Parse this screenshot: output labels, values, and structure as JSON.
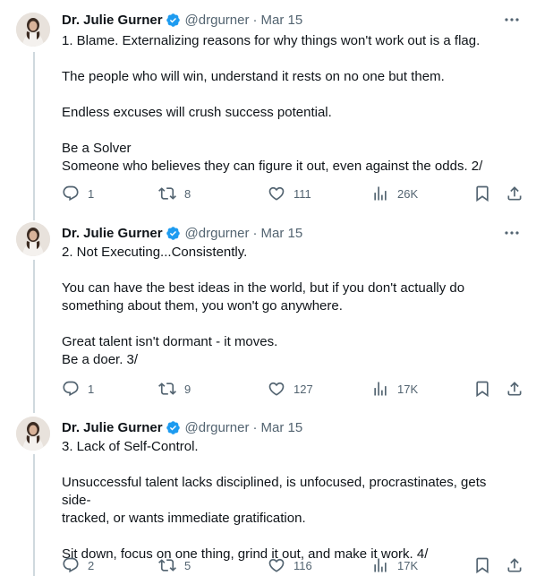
{
  "tweets": [
    {
      "author": {
        "name": "Dr. Julie Gurner",
        "handle": "@drgurner",
        "separator": "·",
        "date": "Mar 15"
      },
      "lines": [
        "1. Blame. Externalizing reasons for why things won't work out is a flag.",
        "",
        "The people who will win, understand it rests on no one but them.",
        "",
        "Endless excuses will crush success potential.",
        "",
        "Be a Solver",
        "Someone who believes they can figure it out, even against the odds.  2/"
      ],
      "stats": {
        "replies": "1",
        "retweets": "8",
        "likes": "111",
        "views": "26K"
      }
    },
    {
      "author": {
        "name": "Dr. Julie Gurner",
        "handle": "@drgurner",
        "separator": "·",
        "date": "Mar 15"
      },
      "lines": [
        "2. Not Executing...Consistently.",
        "",
        "You can have the best ideas in the world, but if you don't actually do",
        "something about them, you won't go anywhere.",
        "",
        "Great talent isn't dormant - it moves.",
        "Be a doer. 3/"
      ],
      "stats": {
        "replies": "1",
        "retweets": "9",
        "likes": "127",
        "views": "17K"
      }
    },
    {
      "author": {
        "name": "Dr. Julie Gurner",
        "handle": "@drgurner",
        "separator": "·",
        "date": "Mar 15"
      },
      "lines": [
        "3. Lack of Self-Control.",
        "",
        "Unsuccessful talent lacks disciplined, is unfocused, procrastinates, gets side-",
        "tracked, or wants immediate gratification.",
        "",
        "Sit down, focus on one thing, grind it out, and make it work. 4/"
      ],
      "stats": {
        "replies": "2",
        "retweets": "5",
        "likes": "116",
        "views": "17K"
      }
    }
  ],
  "colors": {
    "text": "#0f1419",
    "secondary": "#536471",
    "verified": "#1d9bf0",
    "thread_line": "#cfd9de"
  },
  "icons": [
    "more-icon",
    "verified-badge-icon",
    "reply-icon",
    "retweet-icon",
    "like-icon",
    "views-icon",
    "bookmark-icon",
    "share-icon"
  ]
}
